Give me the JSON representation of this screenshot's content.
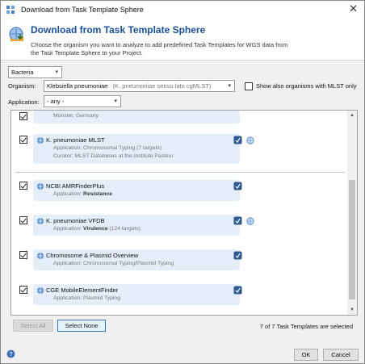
{
  "window": {
    "title": "Download from Task Template Sphere",
    "close_icon": "close-icon"
  },
  "header": {
    "title": "Download from Task Template Sphere",
    "description": "Choose the organism you want to analyze to add predefined Task Templates for WGS data from the Task Template Sphere to your Project."
  },
  "filters": {
    "category": "Bacteria",
    "organism_label": "Organism:",
    "organism_value": "Klebsiella pneumoniae",
    "organism_hint": "(K. pneumoniae sensu lato cgMLST)",
    "show_mlst_label": "Show also organisms with MLST only",
    "application_label": "Application:",
    "application_value": "- any -"
  },
  "templates": {
    "partial": {
      "line": "Münster, Germany"
    },
    "items": [
      {
        "title": "K. pneumoniae MLST",
        "line1_prefix": "Application: ",
        "line1_value": "Chromosomal Typing",
        "line1_suffix": " (7 targets)",
        "line2": "Curator: MLST Databases at the Institute Pasteur"
      },
      {
        "title": "NCBI AMRFinderPlus",
        "line1_prefix": "Application: ",
        "line1_value": "Resistance"
      },
      {
        "title": "K. pneumoniae VFDB",
        "line1_prefix": "Application: ",
        "line1_value": "Virulence",
        "line1_suffix": " (124 targets)"
      },
      {
        "title": "Chromosome & Plasmid Overview",
        "line1_prefix": "Application: ",
        "line1_value": "Chromosomal Typing/Plasmid Typing"
      },
      {
        "title": "CGE MobileElementFinder",
        "line1_prefix": "Application: ",
        "line1_value": "Plasmid Typing"
      }
    ]
  },
  "buttons": {
    "select_all": "Select All",
    "select_none": "Select None",
    "ok": "OK",
    "cancel": "Cancel"
  },
  "status": "7 of 7 Task Templates are selected",
  "colors": {
    "accent": "#1a4f9a",
    "card": "#e4eefa",
    "focus": "#3a76c7"
  }
}
